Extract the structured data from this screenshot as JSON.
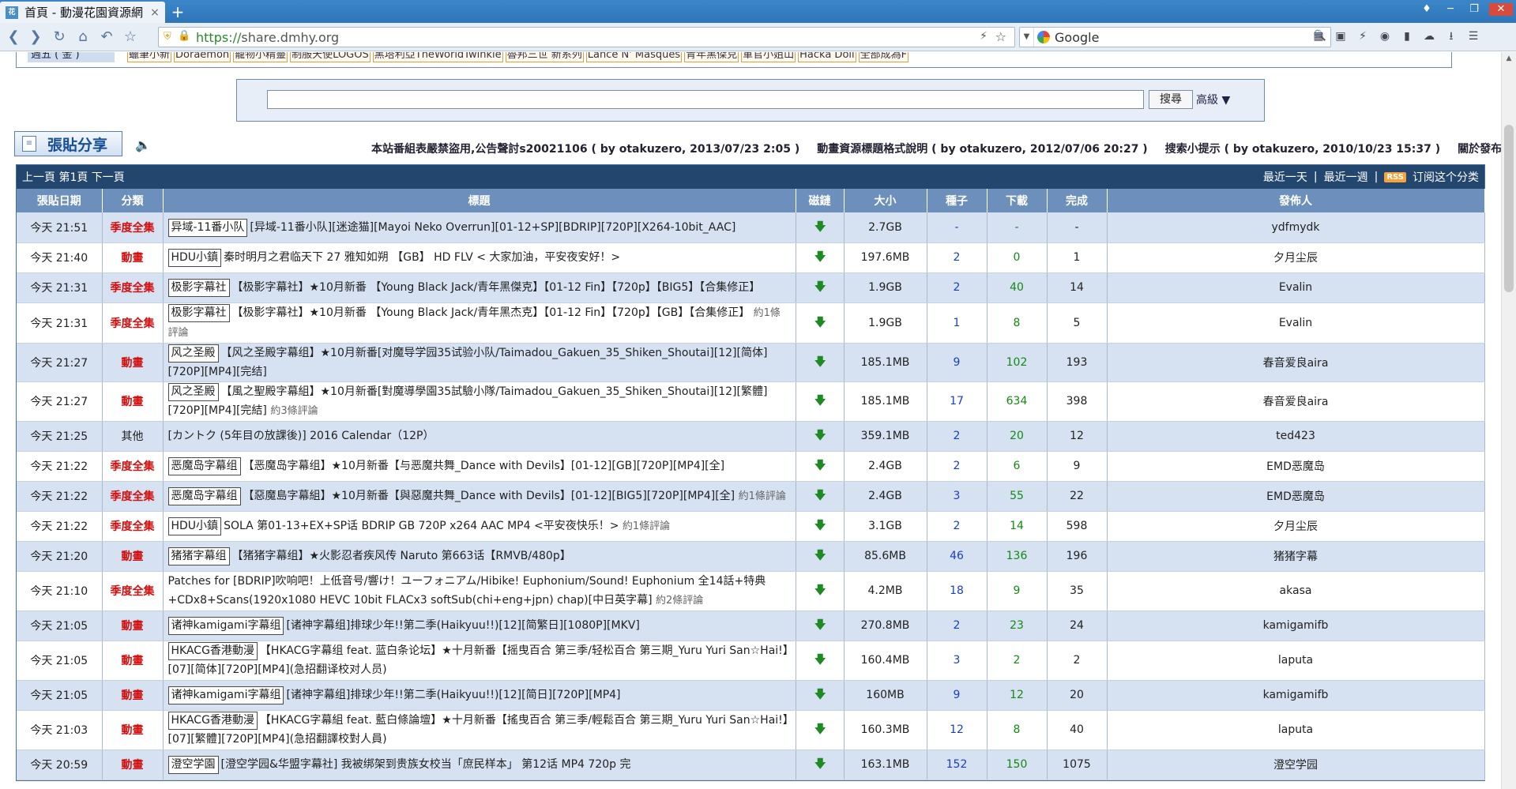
{
  "browser": {
    "tab_title": "首頁 - 動漫花園資源網",
    "tab_close": "×",
    "new_tab": "+",
    "url_scheme": "https://",
    "url_host": "share.dmhy.org",
    "search_engine": "Google"
  },
  "schedule": {
    "day_label": "週五 ( 金 )",
    "shows": [
      "蠟筆小新",
      "Doraemon",
      "寵物小精靈",
      "制服天使LOGOS",
      "黑塔利亞TheWorldTwinkle",
      "魯邦三世 新系列",
      "Lance N' Masques",
      "青年黑傑克",
      "軍官小姐山",
      "Hacka Doll",
      "全部成為F"
    ]
  },
  "search": {
    "button": "搜尋",
    "advanced": "高級 ▼"
  },
  "post_button": "張貼分享",
  "notices": [
    "本站番組表嚴禁盜用,公告聲討s20021106 ( by otakuzero, 2013/07/23 2:05 )",
    "動畫資源標題格式說明 ( by otakuzero, 2012/07/06 20:27 )",
    "搜索小提示 ( by otakuzero, 2010/10/23 15:37 )",
    "關於發布聯盟的申請"
  ],
  "list_header": {
    "pager": "上一頁 第1頁 下一頁",
    "recent_day": "最近一天",
    "sep1": "|",
    "recent_week": "最近一週",
    "sep2": "|",
    "rss": "RSS",
    "subscribe": "订阅这个分类"
  },
  "columns": [
    "張貼日期",
    "分類",
    "標題",
    "磁鏈",
    "大小",
    "種子",
    "下載",
    "完成",
    "發佈人"
  ],
  "rows": [
    {
      "date": "今天 21:51",
      "cat": "季度全集",
      "cat_type": "season",
      "tag": "异域-11番小队",
      "title": "[异域-11番小队][迷途猫][Mayoi Neko Overrun][01-12+SP][BDRIP][720P][X264-10bit_AAC]",
      "comments": "",
      "size": "2.7GB",
      "seeds": "-",
      "dls": "-",
      "done": "-",
      "user": "ydfmydk"
    },
    {
      "date": "今天 21:40",
      "cat": "動畫",
      "cat_type": "anime",
      "tag": "HDU小鎮",
      "title": "秦时明月之君临天下 27 雅知如朔 【GB】 HD FLV < 大家加油，平安夜安好！>",
      "comments": "",
      "size": "197.6MB",
      "seeds": "2",
      "dls": "0",
      "done": "1",
      "user": "夕月尘辰"
    },
    {
      "date": "今天 21:31",
      "cat": "季度全集",
      "cat_type": "season",
      "tag": "极影字幕社",
      "title": "【极影字幕社】★10月新番 【Young Black Jack/青年黑傑克】【01-12 Fin】【720p】【BIG5】【合集修正】",
      "comments": "",
      "size": "1.9GB",
      "seeds": "2",
      "dls": "40",
      "done": "14",
      "user": "Evalin"
    },
    {
      "date": "今天 21:31",
      "cat": "季度全集",
      "cat_type": "season",
      "tag": "极影字幕社",
      "title": "【极影字幕社】★10月新番 【Young Black Jack/青年黑杰克】【01-12 Fin】【720p】【GB】【合集修正】",
      "comments": "約1條評論",
      "size": "1.9GB",
      "seeds": "1",
      "dls": "8",
      "done": "5",
      "user": "Evalin"
    },
    {
      "date": "今天 21:27",
      "cat": "動畫",
      "cat_type": "anime",
      "tag": "风之圣殿",
      "title": "【风之圣殿字幕组】★10月新番[对魔导学园35试验小队/Taimadou_Gakuen_35_Shiken_Shoutai][12][简体][720P][MP4][完结]",
      "comments": "",
      "size": "185.1MB",
      "seeds": "9",
      "dls": "102",
      "done": "193",
      "user": "春音爱良aira"
    },
    {
      "date": "今天 21:27",
      "cat": "動畫",
      "cat_type": "anime",
      "tag": "风之圣殿",
      "title": "【風之聖殿字幕組】★10月新番[對魔導學園35試驗小隊/Taimadou_Gakuen_35_Shiken_Shoutai][12][繁體][720P][MP4][完結]",
      "comments": "約3條評論",
      "size": "185.1MB",
      "seeds": "17",
      "dls": "634",
      "done": "398",
      "user": "春音爱良aira"
    },
    {
      "date": "今天 21:25",
      "cat": "其他",
      "cat_type": "other",
      "tag": "",
      "title": "[カントク (5年目の放課後)] 2016 Calendar（12P）",
      "comments": "",
      "size": "359.1MB",
      "seeds": "2",
      "dls": "20",
      "done": "12",
      "user": "ted423"
    },
    {
      "date": "今天 21:22",
      "cat": "季度全集",
      "cat_type": "season",
      "tag": "恶魔岛字幕组",
      "title": "【恶魔岛字幕组】★10月新番【与恶魔共舞_Dance with Devils】[01-12][GB][720P][MP4][全]",
      "comments": "",
      "size": "2.4GB",
      "seeds": "2",
      "dls": "6",
      "done": "9",
      "user": "EMD恶魔岛"
    },
    {
      "date": "今天 21:22",
      "cat": "季度全集",
      "cat_type": "season",
      "tag": "恶魔岛字幕组",
      "title": "【惡魔島字幕組】★10月新番【與惡魔共舞_Dance with Devils】[01-12][BIG5][720P][MP4][全]",
      "comments": "約1條評論",
      "size": "2.4GB",
      "seeds": "3",
      "dls": "55",
      "done": "22",
      "user": "EMD恶魔岛"
    },
    {
      "date": "今天 21:22",
      "cat": "季度全集",
      "cat_type": "season",
      "tag": "HDU小鎮",
      "title": "SOLA 第01-13+EX+SP话 BDRIP GB 720P x264 AAC MP4 <平安夜快乐！>",
      "comments": "約1條評論",
      "size": "3.1GB",
      "seeds": "2",
      "dls": "14",
      "done": "598",
      "user": "夕月尘辰"
    },
    {
      "date": "今天 21:20",
      "cat": "動畫",
      "cat_type": "anime",
      "tag": "猪猪字幕组",
      "title": "【猪猪字幕组】★火影忍者疾风传 Naruto 第663话【RMVB/480p】",
      "comments": "",
      "size": "85.6MB",
      "seeds": "46",
      "dls": "136",
      "done": "196",
      "user": "猪猪字幕"
    },
    {
      "date": "今天 21:10",
      "cat": "季度全集",
      "cat_type": "season",
      "tag": "",
      "title": "Patches for [BDRIP]吹响吧！上低音号/響け！ユーフォニアム/Hibike! Euphonium/Sound! Euphonium 全14話+特典+CDx8+Scans(1920x1080 HEVC 10bit FLACx3 softSub(chi+eng+jpn) chap)[中日英字幕]",
      "comments": "約2條評論",
      "size": "4.2MB",
      "seeds": "18",
      "dls": "9",
      "done": "35",
      "user": "akasa",
      "tall": true
    },
    {
      "date": "今天 21:05",
      "cat": "動畫",
      "cat_type": "anime",
      "tag": "诸神kamigami字幕组",
      "title": "[诸神字幕组]排球少年!!第二季(Haikyuu!!)[12][简繁日][1080P][MKV]",
      "comments": "",
      "size": "270.8MB",
      "seeds": "2",
      "dls": "23",
      "done": "24",
      "user": "kamigamifb"
    },
    {
      "date": "今天 21:05",
      "cat": "動畫",
      "cat_type": "anime",
      "tag": "HKACG香港動漫",
      "title": "【HKACG字幕组 feat. 蓝白条论坛】★十月新番【摇曳百合 第三季/轻松百合 第三期_Yuru Yuri San☆Hai!】[07][简体][720P][MP4](急招翻译校对人员)",
      "comments": "",
      "size": "160.4MB",
      "seeds": "3",
      "dls": "2",
      "done": "2",
      "user": "laputa",
      "tall": true
    },
    {
      "date": "今天 21:05",
      "cat": "動畫",
      "cat_type": "anime",
      "tag": "诸神kamigami字幕组",
      "title": "[诸神字幕组]排球少年!!第二季(Haikyuu!!)[12][简日][720P][MP4]",
      "comments": "",
      "size": "160MB",
      "seeds": "9",
      "dls": "12",
      "done": "20",
      "user": "kamigamifb"
    },
    {
      "date": "今天 21:03",
      "cat": "動畫",
      "cat_type": "anime",
      "tag": "HKACG香港動漫",
      "title": "【HKACG字幕組 feat. 藍白條論壇】★十月新番【搖曳百合 第三季/輕鬆百合 第三期_Yuru Yuri San☆Hai!】[07][繁體][720P][MP4](急招翻譯校對人員)",
      "comments": "",
      "size": "160.3MB",
      "seeds": "12",
      "dls": "8",
      "done": "40",
      "user": "laputa",
      "tall": true
    },
    {
      "date": "今天 20:59",
      "cat": "動畫",
      "cat_type": "anime",
      "tag": "澄空学園",
      "title": "[澄空学园&华盟字幕社] 我被绑架到贵族女校当「庶民样本」 第12话 MP4 720p 完",
      "comments": "",
      "size": "163.1MB",
      "seeds": "152",
      "dls": "150",
      "done": "1075",
      "user": "澄空学园"
    }
  ]
}
